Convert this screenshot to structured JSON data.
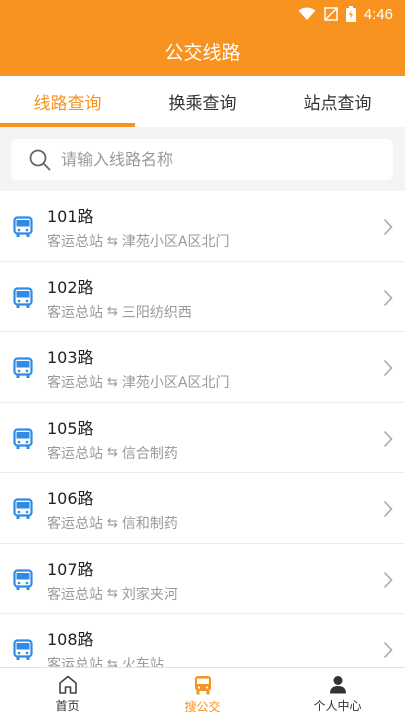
{
  "statusbar": {
    "time": "4:46",
    "wifi_icon": "wifi-icon",
    "signal_icon": "no-signal-icon",
    "battery_icon": "battery-icon"
  },
  "header": {
    "title": "公交线路"
  },
  "tabs": [
    {
      "label": "线路查询",
      "active": true
    },
    {
      "label": "换乘查询",
      "active": false
    },
    {
      "label": "站点查询",
      "active": false
    }
  ],
  "search": {
    "placeholder": "请输入线路名称",
    "value": "",
    "icon": "search-icon"
  },
  "routes": [
    {
      "name": "101路",
      "from": "客运总站",
      "to": "津苑小区A区北门"
    },
    {
      "name": "102路",
      "from": "客运总站",
      "to": "三阳纺织西"
    },
    {
      "name": "103路",
      "from": "客运总站",
      "to": "津苑小区A区北门"
    },
    {
      "name": "105路",
      "from": "客运总站",
      "to": "信合制药"
    },
    {
      "name": "106路",
      "from": "客运总站",
      "to": "信和制药"
    },
    {
      "name": "107路",
      "from": "客运总站",
      "to": "刘家夹河"
    },
    {
      "name": "108路",
      "from": "客运总站",
      "to": "火车站"
    }
  ],
  "route_arrow": "⇆",
  "bottom_nav": [
    {
      "label": "首页",
      "icon": "home-icon",
      "active": false
    },
    {
      "label": "搜公交",
      "icon": "bus-icon",
      "active": true
    },
    {
      "label": "个人中心",
      "icon": "person-icon",
      "active": false
    }
  ],
  "colors": {
    "accent": "#f7931e",
    "bus_icon": "#2f8be6",
    "muted": "#9a9a9a"
  }
}
